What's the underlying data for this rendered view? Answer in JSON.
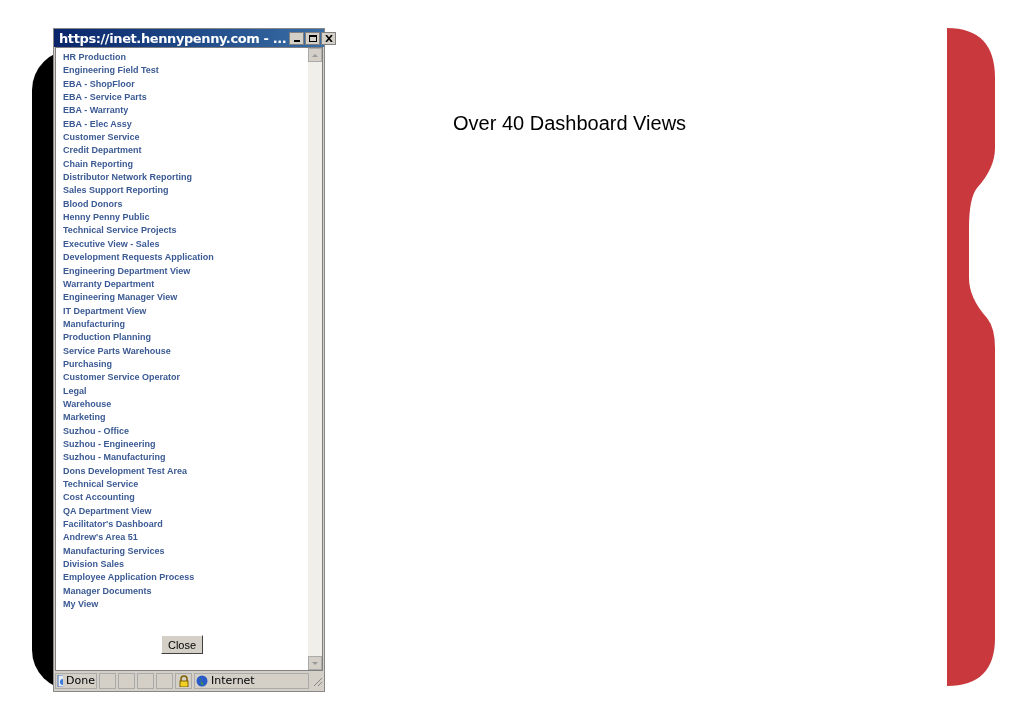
{
  "window": {
    "title": "https://inet.hennypenny.com - ..."
  },
  "links": [
    "HR Production",
    "Engineering Field Test",
    "EBA - ShopFloor",
    "EBA - Service Parts",
    "EBA - Warranty",
    "EBA - Elec Assy",
    "Customer Service",
    "Credit Department",
    "Chain Reporting",
    "Distributor Network Reporting",
    "Sales Support Reporting",
    "Blood Donors",
    "Henny Penny Public",
    "Technical Service Projects",
    "Executive View - Sales",
    "Development Requests Application",
    "Engineering Department View",
    "Warranty Department",
    "Engineering Manager View",
    "IT Department View",
    "Manufacturing",
    "Production Planning",
    "Service Parts Warehouse",
    "Purchasing",
    "Customer Service Operator",
    "Legal",
    "Warehouse",
    "Marketing",
    "Suzhou - Office",
    "Suzhou - Engineering",
    "Suzhou - Manufacturing",
    "Dons Development Test Area",
    "Technical Service",
    "Cost Accounting",
    "QA Department View",
    "Facilitator's Dashboard",
    "Andrew's Area 51",
    "Manufacturing Services",
    "Division Sales",
    "Employee Application Process",
    "Manager Documents",
    "My View"
  ],
  "close_button": "Close",
  "status_bar": {
    "status": "Done",
    "zone": "Internet"
  },
  "slide": {
    "heading": "Over 40 Dashboard Views"
  }
}
